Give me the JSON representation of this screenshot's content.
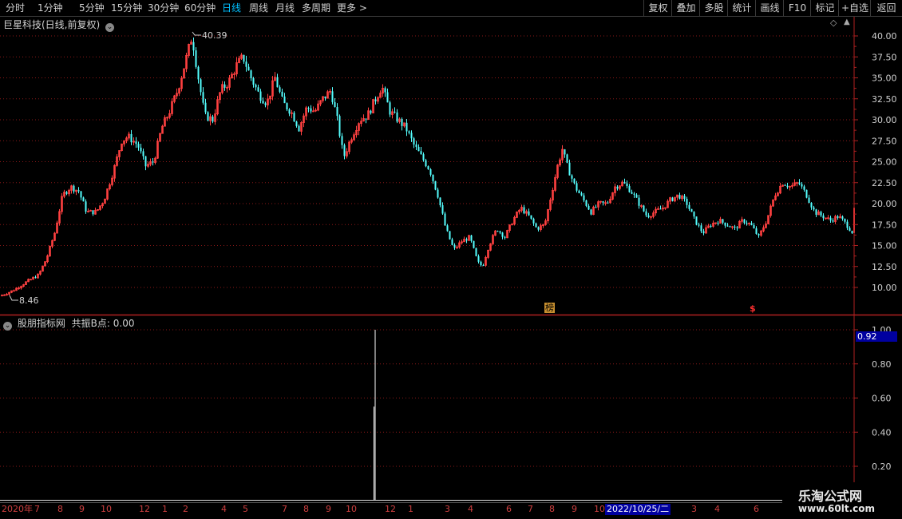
{
  "toolbar": {
    "periods": [
      "分时",
      "1分钟",
      "5分钟",
      "15分钟",
      "30分钟",
      "60分钟",
      "日线",
      "周线",
      "月线",
      "多周期",
      "更多 >"
    ],
    "active_index": 6,
    "right_buttons": [
      "复权",
      "叠加",
      "多股",
      "统计",
      "画线",
      "F10",
      "标记",
      "+自选",
      "返回"
    ]
  },
  "main_chart": {
    "title": "巨星科技(日线,前复权)",
    "high_label": "40.39",
    "low_label": "8.46",
    "y_ticks": [
      "40.00",
      "37.50",
      "35.00",
      "32.50",
      "30.00",
      "27.50",
      "25.00",
      "22.50",
      "20.00",
      "17.50",
      "15.00",
      "12.50",
      "10.00"
    ],
    "marker_bang": "榜",
    "marker_dollar": "$"
  },
  "indicator": {
    "name": "股朋指标网",
    "label": "共振B点: 0.00",
    "current_value": "0.92",
    "y_ticks": [
      "1.00",
      "0.80",
      "0.60",
      "0.40",
      "0.20"
    ]
  },
  "x_axis": {
    "labels": [
      "2020年",
      "7",
      "8",
      "9",
      "10",
      "12",
      "1",
      "2",
      "4",
      "5",
      "7",
      "8",
      "9",
      "10",
      "12",
      "1",
      "3",
      "4",
      "6",
      "7",
      "8",
      "9",
      "10",
      "3",
      "4",
      "6"
    ],
    "crosshair_date": "2022/10/25/二"
  },
  "watermark": {
    "line1": "乐淘公式网",
    "line2": "www.60lt.com"
  },
  "colors": {
    "up": "#ff4040",
    "down": "#54ffff",
    "grid": "#8a1818",
    "frame": "#b02020",
    "text": "#c8c8c8",
    "active": "#00c0ff",
    "highlight": "#0000a0"
  },
  "chart_data": {
    "type": "candlestick",
    "price_range": [
      7.5,
      41.5
    ],
    "key_points_x_price": [
      [
        0,
        9.0
      ],
      [
        15,
        9.6
      ],
      [
        25,
        10.2
      ],
      [
        35,
        10.8
      ],
      [
        48,
        11.5
      ],
      [
        58,
        13.5
      ],
      [
        68,
        16.5
      ],
      [
        78,
        21.0
      ],
      [
        88,
        22.0
      ],
      [
        98,
        21.5
      ],
      [
        108,
        19.0
      ],
      [
        120,
        19.0
      ],
      [
        130,
        20.5
      ],
      [
        142,
        24.0
      ],
      [
        152,
        27.5
      ],
      [
        160,
        28.0
      ],
      [
        172,
        27.0
      ],
      [
        182,
        24.5
      ],
      [
        192,
        25.0
      ],
      [
        202,
        29.0
      ],
      [
        212,
        31.0
      ],
      [
        222,
        33.5
      ],
      [
        232,
        37.0
      ],
      [
        240,
        40.0
      ],
      [
        248,
        35.0
      ],
      [
        256,
        30.5
      ],
      [
        266,
        30.0
      ],
      [
        276,
        33.5
      ],
      [
        286,
        34.5
      ],
      [
        296,
        36.5
      ],
      [
        304,
        37.5
      ],
      [
        314,
        35.0
      ],
      [
        324,
        33.0
      ],
      [
        334,
        32.0
      ],
      [
        344,
        35.0
      ],
      [
        354,
        32.0
      ],
      [
        364,
        31.0
      ],
      [
        374,
        29.0
      ],
      [
        384,
        31.5
      ],
      [
        394,
        31.0
      ],
      [
        404,
        32.5
      ],
      [
        414,
        33.5
      ],
      [
        422,
        30.0
      ],
      [
        430,
        25.5
      ],
      [
        440,
        28.0
      ],
      [
        450,
        30.0
      ],
      [
        460,
        30.5
      ],
      [
        470,
        32.5
      ],
      [
        478,
        34.0
      ],
      [
        488,
        31.0
      ],
      [
        498,
        30.0
      ],
      [
        508,
        29.0
      ],
      [
        518,
        27.0
      ],
      [
        528,
        25.5
      ],
      [
        538,
        24.0
      ],
      [
        548,
        21.0
      ],
      [
        558,
        17.0
      ],
      [
        568,
        14.5
      ],
      [
        578,
        15.5
      ],
      [
        588,
        16.0
      ],
      [
        598,
        13.0
      ],
      [
        604,
        12.5
      ],
      [
        612,
        15.0
      ],
      [
        622,
        17.0
      ],
      [
        632,
        16.0
      ],
      [
        642,
        18.0
      ],
      [
        652,
        19.5
      ],
      [
        662,
        18.5
      ],
      [
        672,
        17.0
      ],
      [
        682,
        17.5
      ],
      [
        690,
        21.0
      ],
      [
        698,
        24.5
      ],
      [
        704,
        26.5
      ],
      [
        710,
        24.5
      ],
      [
        720,
        22.0
      ],
      [
        730,
        20.5
      ],
      [
        740,
        19.0
      ],
      [
        750,
        20.0
      ],
      [
        760,
        20.0
      ],
      [
        770,
        22.0
      ],
      [
        780,
        22.5
      ],
      [
        790,
        21.5
      ],
      [
        800,
        20.0
      ],
      [
        810,
        18.5
      ],
      [
        820,
        19.0
      ],
      [
        830,
        19.5
      ],
      [
        840,
        20.5
      ],
      [
        850,
        21.0
      ],
      [
        860,
        20.0
      ],
      [
        870,
        18.0
      ],
      [
        880,
        16.5
      ],
      [
        890,
        17.5
      ],
      [
        900,
        18.0
      ],
      [
        910,
        17.5
      ],
      [
        920,
        17.0
      ],
      [
        930,
        18.0
      ],
      [
        940,
        17.5
      ],
      [
        950,
        16.0
      ],
      [
        960,
        18.0
      ],
      [
        970,
        21.0
      ],
      [
        980,
        22.5
      ],
      [
        990,
        22.0
      ],
      [
        1000,
        22.5
      ],
      [
        1010,
        21.0
      ],
      [
        1020,
        19.0
      ],
      [
        1030,
        18.5
      ],
      [
        1040,
        18.0
      ],
      [
        1050,
        18.5
      ],
      [
        1060,
        17.5
      ],
      [
        1068,
        16.5
      ]
    ],
    "indicator_spike_x": 470,
    "indicator_spike_value": 1.0
  }
}
